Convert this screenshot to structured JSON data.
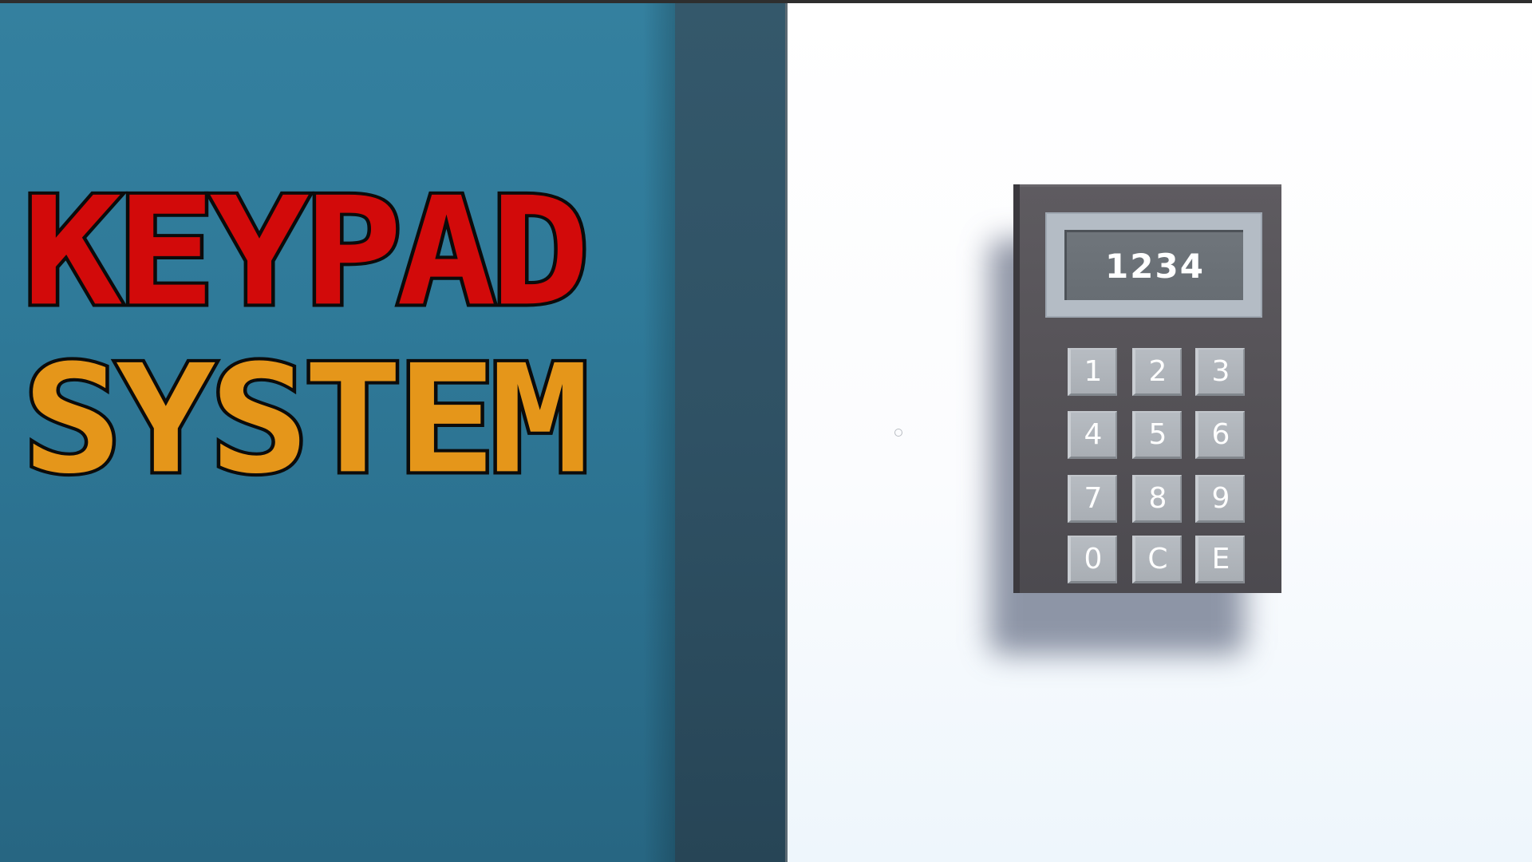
{
  "title": {
    "line1": "KEYPAD",
    "line2": "SYSTEM"
  },
  "colors": {
    "title_red": "#d20a0a",
    "title_orange": "#e5961a",
    "wall_blue": "#2f7a99",
    "keypad_body": "#555257",
    "key_face": "#b0b5bb"
  },
  "keypad": {
    "display": "1234",
    "keys": [
      "1",
      "2",
      "3",
      "4",
      "5",
      "6",
      "7",
      "8",
      "9",
      "0",
      "C",
      "E"
    ]
  }
}
